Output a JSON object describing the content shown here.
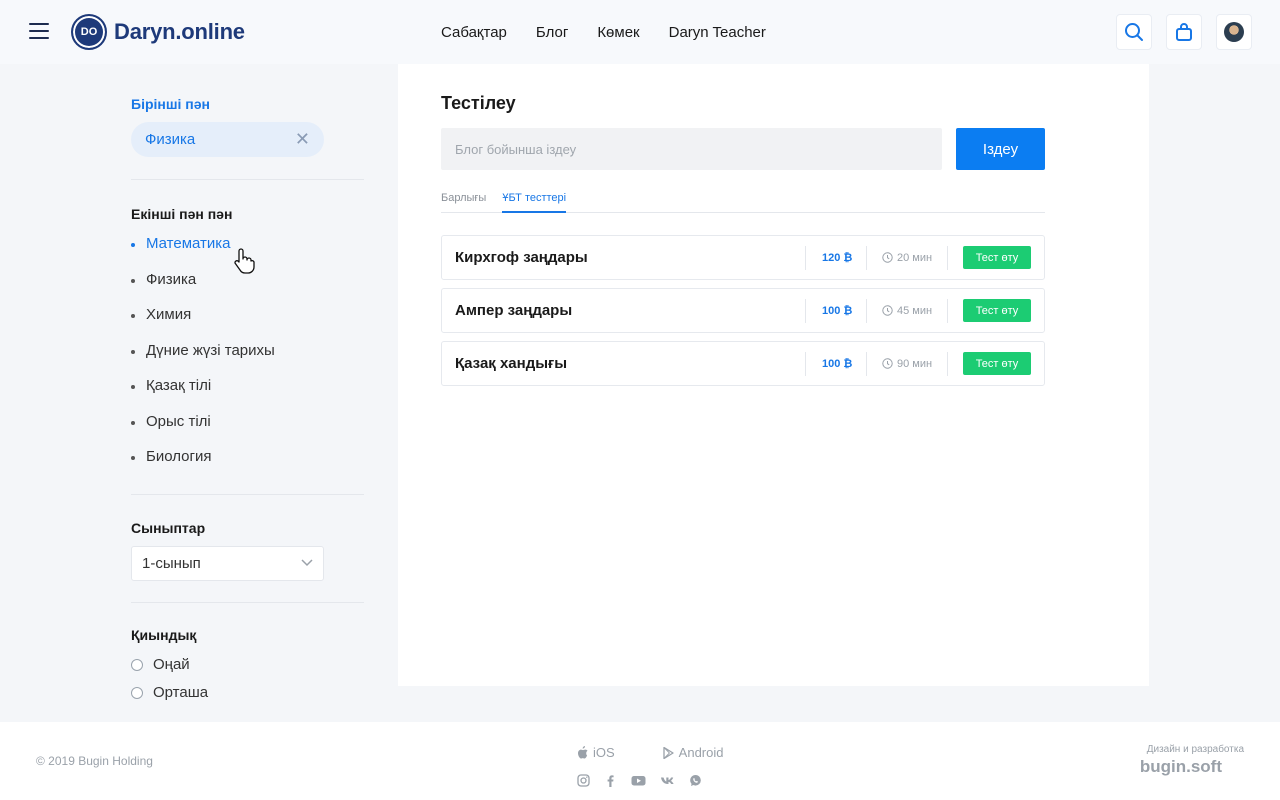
{
  "header": {
    "logo_mark": "DO",
    "logo_text": "Daryn.online",
    "nav": [
      "Сабақтар",
      "Блог",
      "Көмек",
      "Daryn Teacher"
    ]
  },
  "sidebar": {
    "first_subject_title": "Бірінші пән",
    "first_subject_value": "Физика",
    "second_subject_title": "Екінші пән пән",
    "subjects": [
      "Математика",
      "Физика",
      "Химия",
      "Дүние жүзі тарихы",
      "Қазақ тілі",
      "Орыс тілі",
      "Биология"
    ],
    "active_subject": "Математика",
    "grades_title": "Сыныптар",
    "grade_value": "1-сынып",
    "difficulty_title": "Қиындық",
    "difficulty_options": [
      "Оңай",
      "Орташа"
    ]
  },
  "main": {
    "title": "Тестілеу",
    "search_placeholder": "Блог бойынша іздеу",
    "search_button": "Іздеу",
    "tabs": [
      "Барлығы",
      "ҰБТ тесттері"
    ],
    "active_tab": "ҰБТ тесттері",
    "tests": [
      {
        "name": "Кирхгоф заңдары",
        "price": "120",
        "duration": "20 мин",
        "button": "Тест өту"
      },
      {
        "name": "Ампер заңдары",
        "price": "100",
        "duration": "45 мин",
        "button": "Тест өту"
      },
      {
        "name": "Қазақ хандығы",
        "price": "100",
        "duration": "90 мин",
        "button": "Тест өту"
      }
    ]
  },
  "footer": {
    "copyright": "© 2019 Bugin Holding",
    "ios": "iOS",
    "android": "Android",
    "credit_label": "Дизайн и разработка",
    "credit_brand": "bugin.soft"
  },
  "colors": {
    "accent": "#0b7df2",
    "brand": "#1e3a7a",
    "success": "#1ccc73"
  }
}
